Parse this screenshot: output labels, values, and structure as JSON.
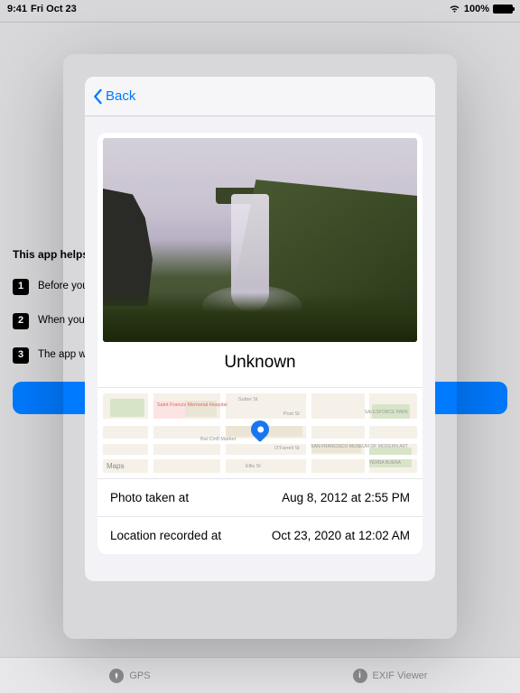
{
  "status": {
    "time": "9:41",
    "date": "Fri Oct 23",
    "battery_pct": "100%"
  },
  "background": {
    "title": "This app helps you",
    "steps": [
      "Before you",
      "When you ... select the pictures to import",
      "The app w... as and add the GPS coordinat"
    ]
  },
  "tabs": {
    "gps": "GPS",
    "exif": "EXIF Viewer"
  },
  "modal": {
    "back_label": "Back",
    "photo_title": "Unknown",
    "map_attribution": "Maps",
    "rows": [
      {
        "label": "Photo taken at",
        "value": "Aug 8, 2012 at 2:55 PM"
      },
      {
        "label": "Location recorded at",
        "value": "Oct 23, 2020 at 12:02 AM"
      }
    ]
  }
}
